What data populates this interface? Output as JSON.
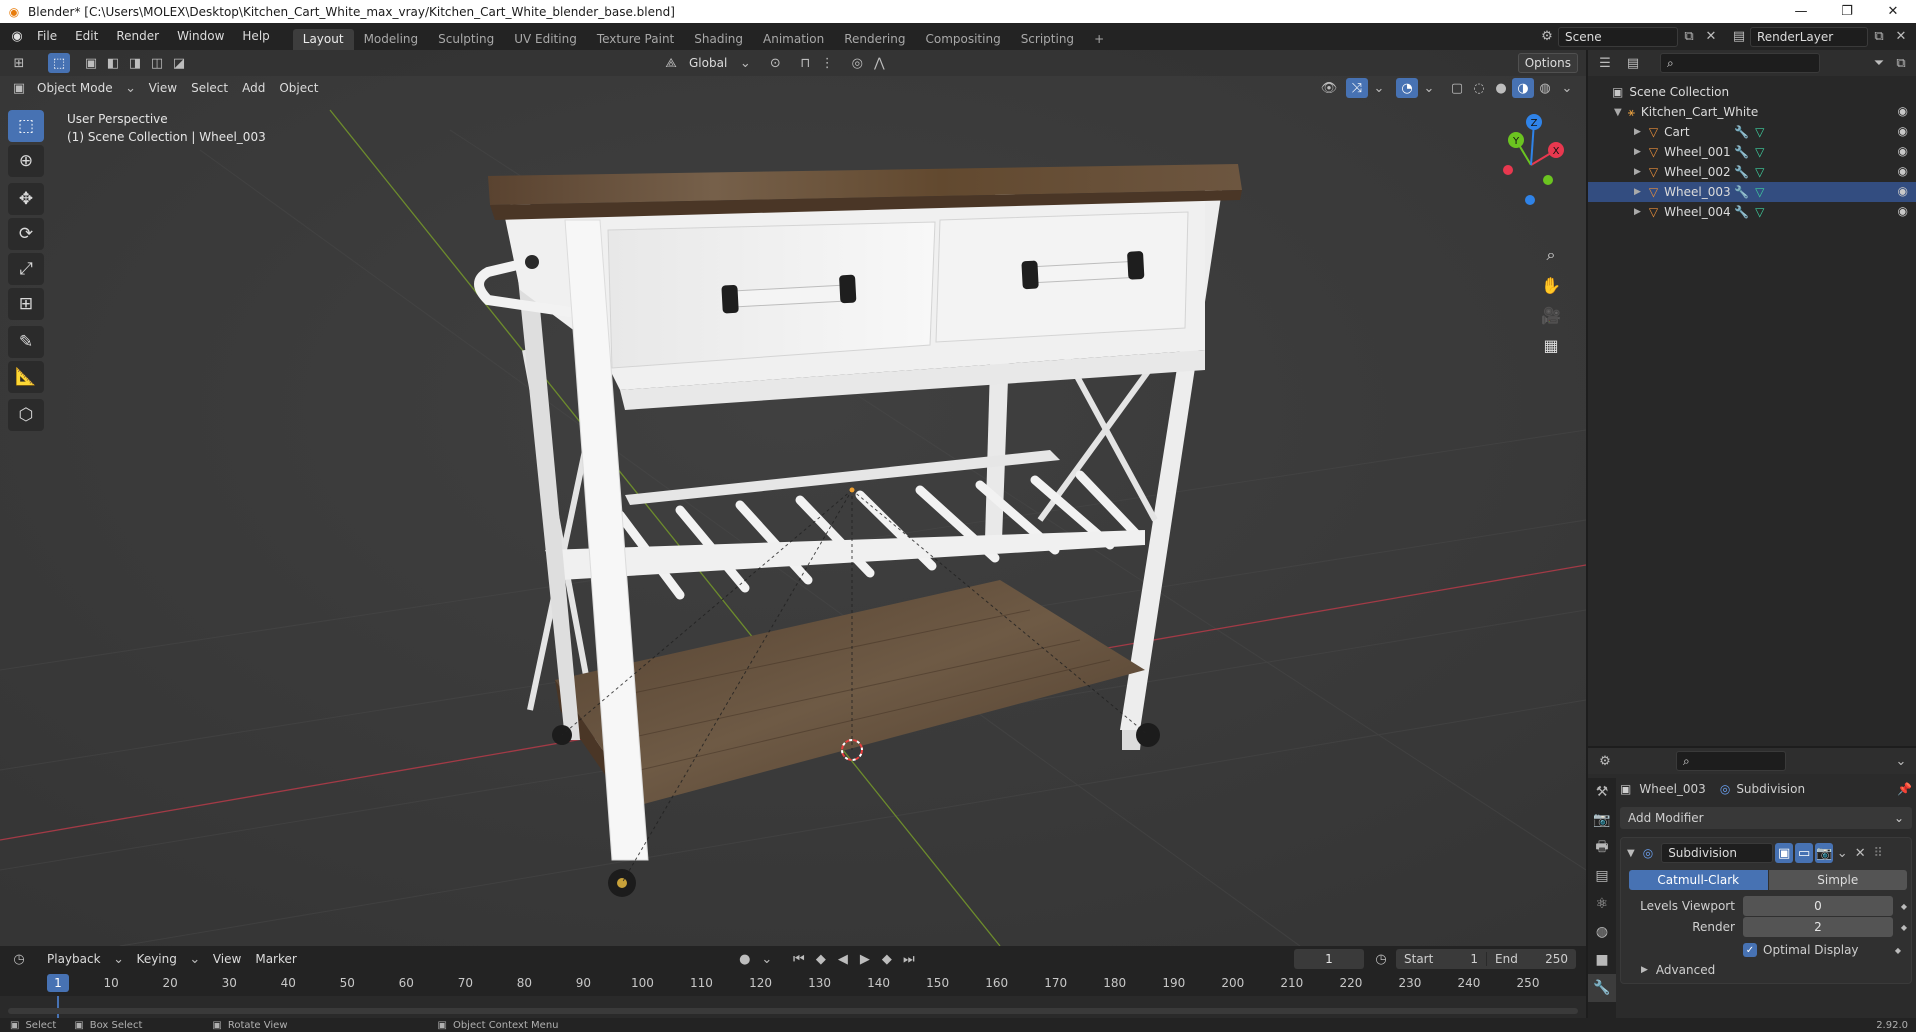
{
  "window": {
    "title": "Blender* [C:\\Users\\MOLEX\\Desktop\\Kitchen_Cart_White_max_vray/Kitchen_Cart_White_blender_base.blend]",
    "minimize": "—",
    "restore": "❐",
    "close": "✕"
  },
  "menu": [
    "File",
    "Edit",
    "Render",
    "Window",
    "Help"
  ],
  "workspaces": [
    {
      "label": "Layout",
      "active": true
    },
    {
      "label": "Modeling"
    },
    {
      "label": "Sculpting"
    },
    {
      "label": "UV Editing"
    },
    {
      "label": "Texture Paint"
    },
    {
      "label": "Shading"
    },
    {
      "label": "Animation"
    },
    {
      "label": "Rendering"
    },
    {
      "label": "Compositing"
    },
    {
      "label": "Scripting"
    }
  ],
  "add_workspace": "+",
  "scene": {
    "name": "Scene",
    "render_layer": "RenderLayer"
  },
  "viewport": {
    "transform_orientation": "Global",
    "options": "Options",
    "mode": "Object Mode",
    "header_menu": [
      "View",
      "Select",
      "Add",
      "Object"
    ],
    "perspective": "User Perspective",
    "collection_info": "(1) Scene Collection | Wheel_003",
    "gizmo_axes": {
      "x": "X",
      "y": "Y",
      "z": "Z"
    }
  },
  "outliner": {
    "root": "Scene Collection",
    "collection": "Kitchen_Cart_White",
    "items": [
      {
        "name": "Cart",
        "selected": false
      },
      {
        "name": "Wheel_001",
        "selected": false
      },
      {
        "name": "Wheel_002",
        "selected": false
      },
      {
        "name": "Wheel_003",
        "selected": true
      },
      {
        "name": "Wheel_004",
        "selected": false
      }
    ]
  },
  "properties": {
    "object": "Wheel_003",
    "modifier_crumb": "Subdivision",
    "add_modifier": "Add Modifier",
    "modifier_name": "Subdivision",
    "catmull": "Catmull-Clark",
    "simple": "Simple",
    "levels_viewport_label": "Levels Viewport",
    "levels_viewport": "0",
    "render_label": "Render",
    "render_value": "2",
    "optimal_display": "Optimal Display",
    "advanced": "Advanced"
  },
  "timeline": {
    "menu": [
      "Playback",
      "Keying",
      "View",
      "Marker"
    ],
    "current_frame": "1",
    "start_label": "Start",
    "start": "1",
    "end_label": "End",
    "end": "250",
    "ticks": [
      "1",
      "10",
      "20",
      "30",
      "40",
      "50",
      "60",
      "70",
      "80",
      "90",
      "100",
      "110",
      "120",
      "130",
      "140",
      "150",
      "160",
      "170",
      "180",
      "190",
      "200",
      "210",
      "220",
      "230",
      "240",
      "250"
    ]
  },
  "statusbar": {
    "select": "Select",
    "box_select": "Box Select",
    "rotate_view": "Rotate View",
    "context_menu": "Object Context Menu",
    "version": "2.92.0"
  },
  "colors": {
    "accent": "#4772b3",
    "x_axis": "#e8384f",
    "y_axis": "#6bc420",
    "z_axis": "#2f83e8",
    "mesh_icon": "#e88e3a",
    "modifier_icon": "#6ba0f0"
  }
}
